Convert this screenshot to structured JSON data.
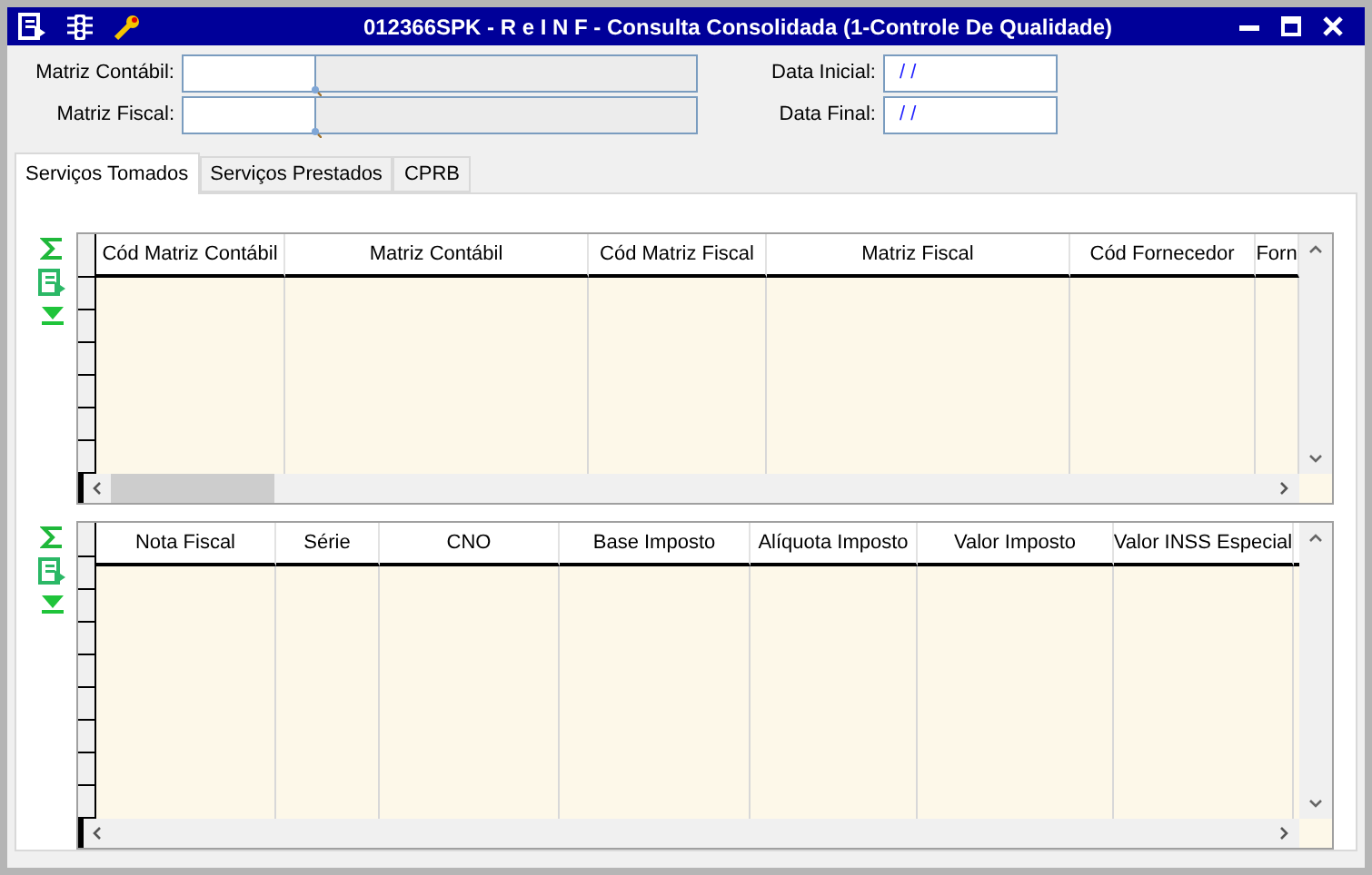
{
  "window": {
    "title": "012366SPK - R e I N F - Consulta Consolidada (1-Controle De Qualidade)"
  },
  "lookup_fields": [
    {
      "label": "Matriz Contábil:"
    },
    {
      "label": "Matriz Fiscal:"
    }
  ],
  "date_fields": [
    {
      "label": "Data Inicial:",
      "value": "/ /"
    },
    {
      "label": "Data Final:",
      "value": "/ /"
    }
  ],
  "tabs": [
    {
      "label": "Serviços Tomados",
      "selected": true
    },
    {
      "label": "Serviços Prestados",
      "selected": false
    },
    {
      "label": "CPRB",
      "selected": false
    }
  ],
  "grids": [
    {
      "columns": [
        "Cód Matriz Contábil",
        "Matriz Contábil",
        "Cód Matriz Fiscal",
        "Matriz Fiscal",
        "Cód Fornecedor",
        "Forn"
      ]
    },
    {
      "columns": [
        "Nota Fiscal",
        "Série",
        "CNO",
        "Base Imposto",
        "Alíquota Imposto",
        "Valor Imposto",
        "Valor INSS Especial"
      ]
    }
  ]
}
